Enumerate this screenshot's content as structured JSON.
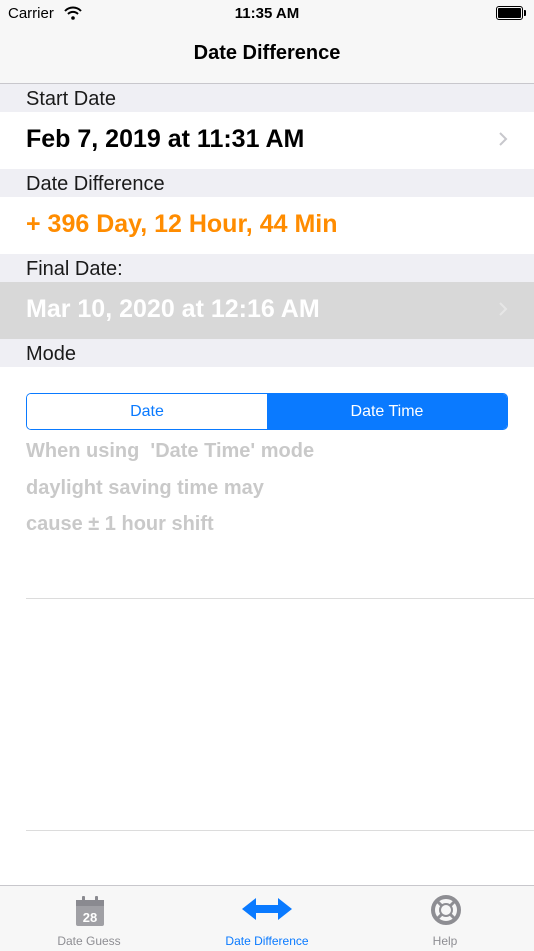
{
  "status_bar": {
    "carrier": "Carrier",
    "time": "11:35 AM",
    "battery_level": 1.0
  },
  "nav": {
    "title": "Date Difference"
  },
  "sections": {
    "start_header": "Start Date",
    "start_value": "Feb 7, 2019 at 11:31 AM",
    "diff_header": "Date Difference",
    "diff_value": "+ 396 Day, 12 Hour, 44 Min",
    "final_header": "Final Date:",
    "final_value": "Mar 10, 2020 at 12:16 AM",
    "mode_header": "Mode"
  },
  "mode": {
    "options": [
      "Date",
      "Date Time"
    ],
    "selected": "Date Time"
  },
  "note": {
    "lines": [
      "When using  'Date Time' mode",
      "daylight saving time may",
      "cause ± 1 hour shift"
    ]
  },
  "tabs": [
    {
      "label": "Date Guess",
      "icon": "calendar-icon",
      "badge": "28"
    },
    {
      "label": "Date Difference",
      "icon": "double-arrow-icon",
      "active": true
    },
    {
      "label": "Help",
      "icon": "lifebuoy-icon"
    }
  ],
  "colors": {
    "accent": "#0a7aff",
    "difference": "#ff8c00",
    "final_row_bg": "#d8d8d8",
    "note_text": "#c9c9c9"
  }
}
